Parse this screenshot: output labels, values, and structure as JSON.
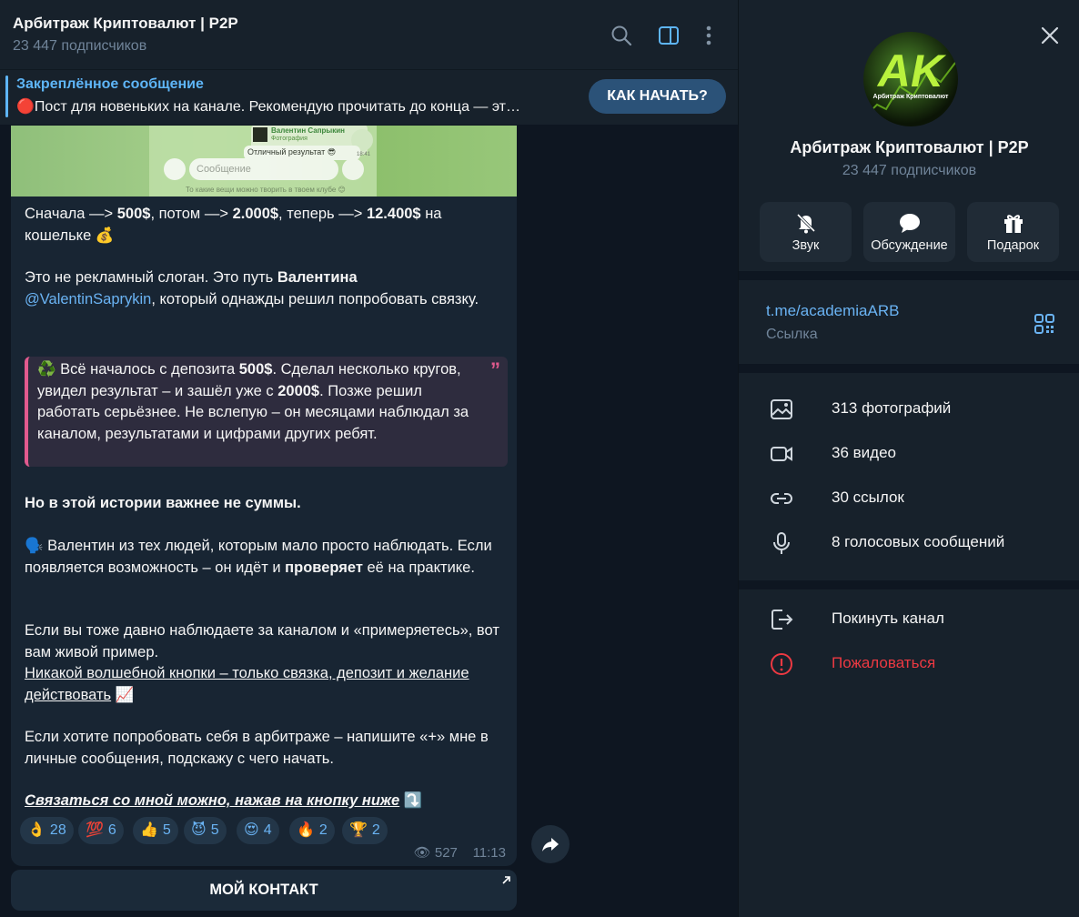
{
  "chat": {
    "title": "Арбитраж Криптовалют | P2P",
    "subscribers": "23 447 подписчиков",
    "pinned": {
      "title": "Закреплённое сообщение",
      "text": "🔴Пост для новеньких на канале. Рекомендую прочитать до конца — эт…",
      "button": "КАК НАЧАТЬ?"
    },
    "photo_preview": {
      "sender": "Валентин Сапрыкин",
      "caption": "Фотография",
      "result": "Отличный результат 😎",
      "time": "18:41",
      "input_placeholder": "Сообщение",
      "bottom_text": "То какие вещи можно творить в твоем клубе 😊"
    },
    "message": {
      "p1_a": "Сначала —> ",
      "p1_b": "500$",
      "p1_c": ", потом —> ",
      "p1_d": "2.000$",
      "p1_e": ", теперь —> ",
      "p1_f": "12.400$",
      "p1_g": " на кошельке 💰",
      "p2_a": "Это не рекламный слоган. Это путь ",
      "p2_b": "Валентина",
      "p2_link": "@ValentinSaprykin",
      "p2_c": ", который однажды решил попробовать связку.",
      "quote_a": "♻️ Всё началось с депозита ",
      "quote_b": "500$",
      "quote_c": ". Сделал несколько кругов, увидел результат – и зашёл уже с ",
      "quote_d": "2000$",
      "quote_e": ". Позже решил работать серьёзнее. Не вслепую – он месяцами наблюдал за каналом, результатами и цифрами других ребят.",
      "p3": "Но в этой истории важнее не суммы.",
      "p4_a": "🗣️ Валентин из тех людей, которым мало просто наблюдать. Если появляется возможность – он идёт и ",
      "p4_b": "проверяет",
      "p4_c": " её на практике.",
      "p5": "Если вы тоже давно наблюдаете за каналом и «примеряетесь», вот вам живой пример.",
      "p6": "Никакой волшебной кнопки – только связка, депозит и желание действовать",
      "p6_emoji": " 📈",
      "p7": "Если хотите попробовать себя в арбитраже – напишите «+» мне в личные сообщения, подскажу с чего начать.",
      "p8": "Связаться со мной можно, нажав на кнопку ниже",
      "p8_emoji": " ⤵️"
    },
    "reactions": [
      {
        "emoji": "👌",
        "count": "28"
      },
      {
        "emoji": "💯",
        "count": "6"
      },
      {
        "emoji": "👍",
        "count": "5"
      },
      {
        "emoji": "😈",
        "count": "5"
      },
      {
        "emoji": "😍",
        "count": "4"
      },
      {
        "emoji": "🔥",
        "count": "2"
      },
      {
        "emoji": "🏆",
        "count": "2"
      }
    ],
    "views": "527",
    "time": "11:13",
    "contact_button": "МОЙ КОНТАКТ"
  },
  "panel": {
    "avatar_letters": "AK",
    "avatar_caption": "Арбитраж Криптовалют",
    "title": "Арбитраж Криптовалют | P2P",
    "subscribers": "23 447 подписчиков",
    "buttons": [
      {
        "label": "Звук",
        "icon": "bell-off-icon"
      },
      {
        "label": "Обсуждение",
        "icon": "chat-bubble-icon"
      },
      {
        "label": "Подарок",
        "icon": "gift-icon"
      }
    ],
    "link": {
      "url": "t.me/academiaARB",
      "caption": "Ссылка"
    },
    "media": [
      {
        "label": "313 фотографий",
        "icon": "photo-icon"
      },
      {
        "label": "36 видео",
        "icon": "video-icon"
      },
      {
        "label": "30 ссылок",
        "icon": "link-icon"
      },
      {
        "label": "8 голосовых сообщений",
        "icon": "microphone-icon"
      }
    ],
    "actions": [
      {
        "label": "Покинуть канал",
        "icon": "leave-icon"
      },
      {
        "label": "Пожаловаться",
        "icon": "report-icon"
      }
    ]
  },
  "colors": {
    "accent": "#6ab3f3",
    "danger": "#ec3942",
    "quote_border": "#e15a8e",
    "bubble": "#182533",
    "panel": "#17212b"
  }
}
